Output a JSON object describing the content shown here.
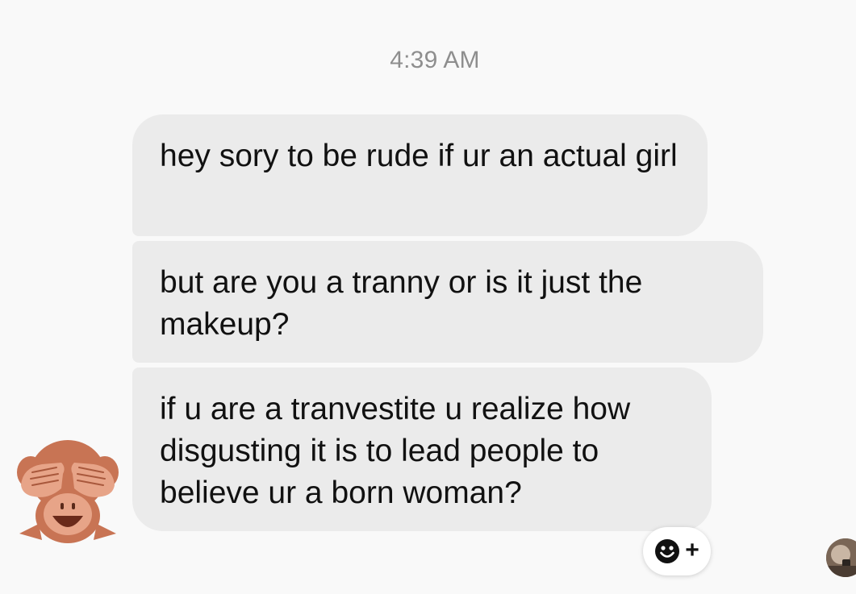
{
  "timestamp": "4:39 AM",
  "messages": [
    {
      "text": "hey sory to be rude if ur an actual girl"
    },
    {
      "text": "but are you a tranny or is it just the makeup?"
    },
    {
      "text": "if u are a tranvestite u realize how disgusting it is to lead people to believe ur a born woman?"
    }
  ],
  "sender_avatar_icon": "see-no-evil-monkey-icon",
  "reaction_button": {
    "icon": "smiley-icon",
    "plus": "+"
  },
  "read_receipt_avatar_icon": "user-avatar-icon",
  "colors": {
    "background": "#f9f9f9",
    "bubble": "#ebebeb",
    "timestamp": "#8e8e8e",
    "monkey": "#c87454"
  }
}
